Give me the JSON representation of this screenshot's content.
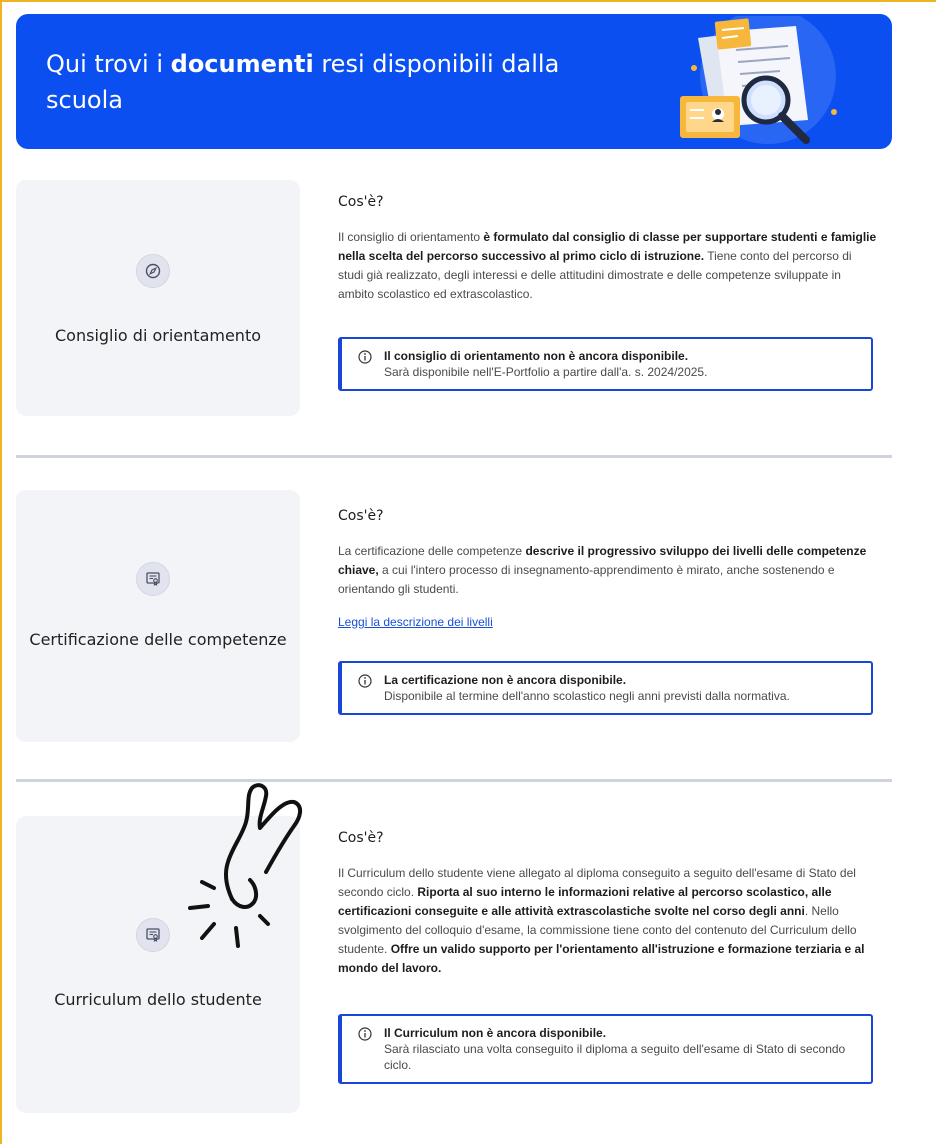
{
  "banner": {
    "title_prefix": "Qui trovi i ",
    "title_bold": "documenti",
    "title_suffix": " resi disponibili dalla scuola"
  },
  "sections": [
    {
      "card_title": "Consiglio di orientamento",
      "icon": "compass-icon",
      "question": "Cos'è?",
      "desc_1": "Il consiglio di orientamento ",
      "desc_1_bold": "è formulato dal consiglio di classe per supportare studenti e famiglie nella scelta del percorso successivo al primo ciclo di istruzione.",
      "desc_2": " Tiene conto del percorso di studi già realizzato, degli interessi e delle attitudini dimostrate e delle competenze sviluppate in ambito scolastico ed extrascolastico.",
      "notice_title": "Il consiglio di orientamento non è ancora disponibile.",
      "notice_sub": "Sarà disponibile nell'E-Portfolio a partire dall'a. s. 2024/2025."
    },
    {
      "card_title": "Certificazione delle competenze",
      "icon": "certificate-icon",
      "question": "Cos'è?",
      "desc_1": "La certificazione delle competenze ",
      "desc_1_bold": "descrive il progressivo sviluppo dei livelli delle competenze chiave,",
      "desc_2": " a cui l'intero processo di insegnamento-apprendimento è mirato, anche sostenendo e orientando gli studenti.",
      "link": "Leggi la descrizione dei livelli",
      "notice_title": "La certificazione non è ancora disponibile.",
      "notice_sub": "Disponibile al termine dell'anno scolastico negli anni previsti dalla normativa."
    },
    {
      "card_title": "Curriculum dello studente",
      "icon": "certificate-icon",
      "question": "Cos'è?",
      "desc_1": "Il Curriculum dello studente viene allegato al diploma conseguito a seguito dell'esame di Stato del secondo ciclo. ",
      "desc_1_bold": "Riporta al suo interno le informazioni relative al percorso scolastico, alle certificazioni conseguite e alle attività extrascolastiche svolte nel corso degli anni",
      "desc_2": ". Nello svolgimento del colloquio d'esame, la commissione tiene conto del contenuto del Curriculum dello studente. ",
      "desc_2_bold": "Offre un valido supporto per l'orientamento all'istruzione e formazione terziaria e al mondo del lavoro.",
      "notice_title": "Il Curriculum non è ancora disponibile.",
      "notice_sub": "Sarà rilasciato una volta conseguito il diploma a seguito dell'esame di Stato di secondo ciclo."
    }
  ],
  "colors": {
    "banner_blue": "#0b4ff0",
    "notice_border": "#1a46d8",
    "frame_accent": "#f0b323"
  }
}
